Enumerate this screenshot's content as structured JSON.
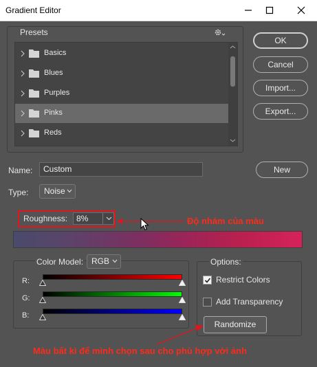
{
  "window": {
    "title": "Gradient Editor"
  },
  "presets": {
    "label": "Presets",
    "items": [
      {
        "label": "Basics",
        "selected": false
      },
      {
        "label": "Blues",
        "selected": false
      },
      {
        "label": "Purples",
        "selected": false
      },
      {
        "label": "Pinks",
        "selected": true
      },
      {
        "label": "Reds",
        "selected": false
      }
    ]
  },
  "buttons": {
    "ok": "OK",
    "cancel": "Cancel",
    "import": "Import...",
    "export": "Export...",
    "new": "New"
  },
  "name": {
    "label": "Name:",
    "value": "Custom"
  },
  "type": {
    "label": "Type:",
    "value": "Noise"
  },
  "roughness": {
    "label": "Roughness:",
    "value": "8%"
  },
  "annotations": {
    "roughness_note": "Độ nhám của màu",
    "randomize_note": "Màu bất kì để mình chọn sau cho phù hợp với ảnh"
  },
  "color_model": {
    "label": "Color Model:",
    "value": "RGB",
    "channels": [
      {
        "label": "R:",
        "color": "#ff0000"
      },
      {
        "label": "G:",
        "color": "#00ff00"
      },
      {
        "label": "B:",
        "color": "#0000ff"
      }
    ]
  },
  "options": {
    "label": "Options:",
    "restrict_colors": {
      "label": "Restrict Colors",
      "checked": true
    },
    "add_transparency": {
      "label": "Add Transparency",
      "checked": false
    },
    "randomize": "Randomize"
  },
  "colors": {
    "annotation": "#ff2a1a",
    "highlight_box": "#e3141c"
  }
}
